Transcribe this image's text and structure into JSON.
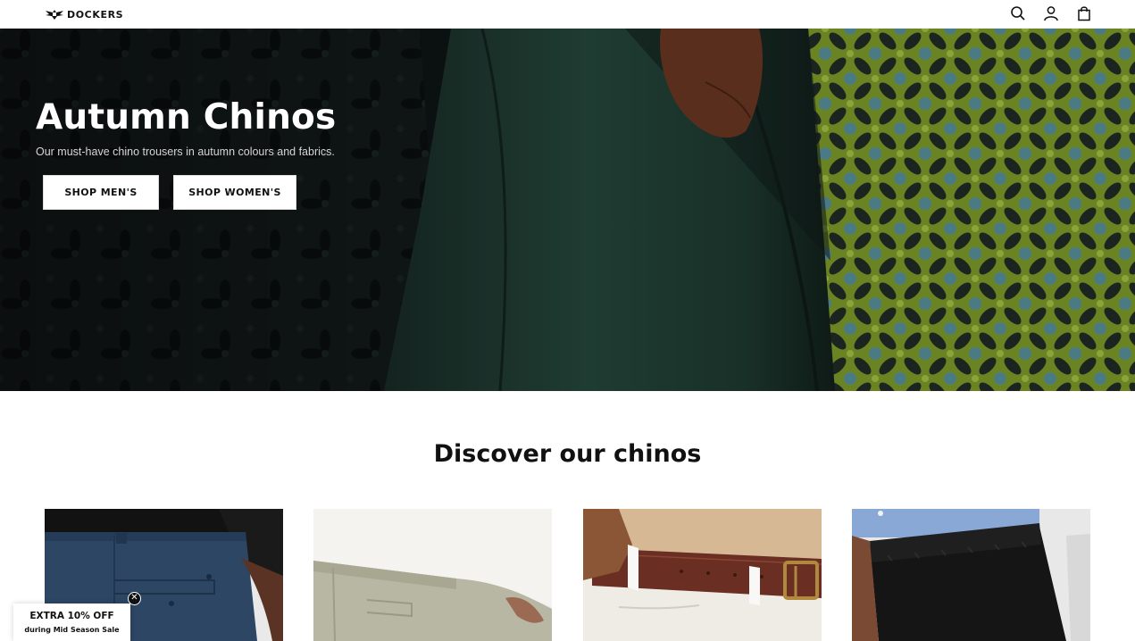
{
  "header": {
    "logo_text": "DOCKERS",
    "icons": [
      "search-icon",
      "account-icon",
      "cart-icon"
    ]
  },
  "hero": {
    "title": "Autumn Chinos",
    "subtitle": "Our must-have chino trousers in autumn colours and fabrics.",
    "buttons": [
      {
        "label": "SHOP MEN'S"
      },
      {
        "label": "SHOP WOMEN'S"
      }
    ]
  },
  "discover": {
    "title": "Discover our chinos",
    "cards": [
      {
        "name": "navy-chino"
      },
      {
        "name": "khaki-chino"
      },
      {
        "name": "white-chino-belt"
      },
      {
        "name": "black-pull-on-chino"
      }
    ]
  },
  "promo": {
    "title": "EXTRA 10% OFF",
    "subtitle": "during Mid Season Sale",
    "close_glyph": "✕"
  },
  "colors": {
    "hero_dark": "#101614",
    "trouser_green": "#1e3a30",
    "pattern_green": "#6e8a24",
    "pattern_blue": "#3f6a78",
    "text_dark": "#111111"
  }
}
